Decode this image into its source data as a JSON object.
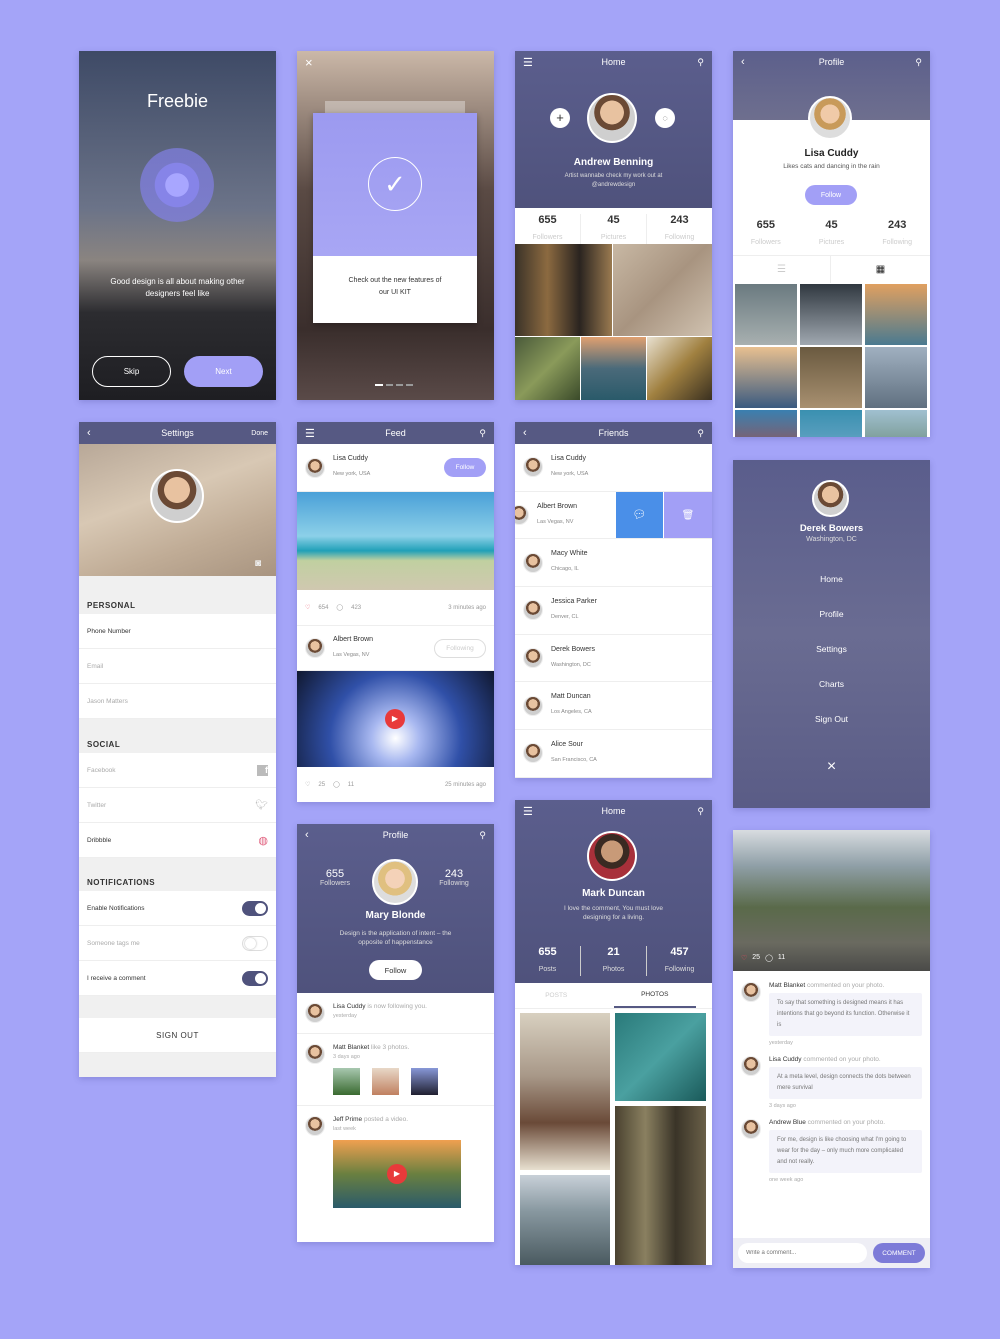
{
  "colors": {
    "background": "#a4a4f8",
    "accent": "#a29ff6",
    "header": "#565983",
    "action_blue": "#4a8fe8",
    "like_red": "#e84a5f"
  },
  "freebie": {
    "title": "Freebie",
    "tagline": "Good design is all about making other designers feel like",
    "skip": "Skip",
    "next": "Next"
  },
  "walkthrough": {
    "message": "Check out the new features of our UI KIT",
    "pages": 4,
    "active_page": 1
  },
  "home_andrew": {
    "title": "Home",
    "name": "Andrew Benning",
    "bio": "Artist wannabe check my work out at @andrewdesign",
    "stats": [
      {
        "value": "655",
        "label": "Followers"
      },
      {
        "value": "45",
        "label": "Pictures"
      },
      {
        "value": "243",
        "label": "Following"
      }
    ]
  },
  "profile_lisa": {
    "title": "Profile",
    "name": "Lisa Cuddy",
    "bio": "Likes cats and dancing in the rain",
    "follow": "Follow",
    "stats": [
      {
        "value": "655",
        "label": "Followers"
      },
      {
        "value": "45",
        "label": "Pictures"
      },
      {
        "value": "243",
        "label": "Following"
      }
    ],
    "active_view": "grid"
  },
  "settings": {
    "title": "Settings",
    "done": "Done",
    "personal": "PERSONAL",
    "personal_items": [
      "Phone Number",
      "Email",
      "Jason Matters"
    ],
    "social": "SOCIAL",
    "social_items": [
      "Facebook",
      "Twitter",
      "Dribbble"
    ],
    "notifications": "NOTIFICATIONS",
    "notification_items": [
      {
        "label": "Enable Notifications",
        "on": true
      },
      {
        "label": "Someone tags me",
        "on": false
      },
      {
        "label": "I receive a comment",
        "on": true
      }
    ],
    "sign_out": "SIGN OUT"
  },
  "feed": {
    "title": "Feed",
    "posts": [
      {
        "name": "Lisa Cuddy",
        "location": "New york, USA",
        "button": "Follow",
        "likes": "654",
        "comments": "423",
        "time": "3 minutes ago"
      },
      {
        "name": "Albert Brown",
        "location": "Las Vegas, NV",
        "button": "Following",
        "likes": "25",
        "comments": "11",
        "time": "25 minutes ago"
      }
    ]
  },
  "friends": {
    "title": "Friends",
    "items": [
      {
        "name": "Lisa Cuddy",
        "location": "New york, USA"
      },
      {
        "name": "Albert Brown",
        "location": "Las Vegas, NV"
      },
      {
        "name": "Macy White",
        "location": "Chicago, IL"
      },
      {
        "name": "Jessica Parker",
        "location": "Denver, CL"
      },
      {
        "name": "Derek Bowers",
        "location": "Washington, DC"
      },
      {
        "name": "Matt Duncan",
        "location": "Los Angeles, CA"
      },
      {
        "name": "Alice Sour",
        "location": "San Francisco, CA"
      }
    ]
  },
  "menu": {
    "name": "Derek Bowers",
    "location": "Washington, DC",
    "items": [
      "Home",
      "Profile",
      "Settings",
      "Charts",
      "Sign Out"
    ]
  },
  "profile_mary": {
    "title": "Profile",
    "name": "Mary Blonde",
    "bio": "Design is the application of intent – the opposite of happenstance",
    "follow": "Follow",
    "followers": {
      "value": "655",
      "label": "Followers"
    },
    "following": {
      "value": "243",
      "label": "Following"
    },
    "activity": [
      {
        "name": "Lisa Cuddy",
        "action": "is now following you.",
        "time": "yesterday"
      },
      {
        "name": "Matt Blanket",
        "action": "like 3 photos.",
        "time": "3 days ago"
      },
      {
        "name": "Jeff Prime",
        "action": "posted a video.",
        "time": "last week"
      }
    ]
  },
  "home_mark": {
    "title": "Home",
    "name": "Mark Duncan",
    "bio": "I love the comment, You must love designing for a living.",
    "stats": [
      {
        "value": "655",
        "label": "Posts"
      },
      {
        "value": "21",
        "label": "Photos"
      },
      {
        "value": "457",
        "label": "Following"
      }
    ],
    "tabs": [
      "POSTS",
      "PHOTOS"
    ],
    "active_tab": "PHOTOS"
  },
  "comments": {
    "likes": "25",
    "comment_count": "11",
    "items": [
      {
        "name": "Matt Blanket",
        "action": "commented on your photo.",
        "text": "To say that something is designed means it has intentions that go beyond its function. Otherwise it is",
        "time": "yesterday"
      },
      {
        "name": "Lisa Cuddy",
        "action": "commented on your photo.",
        "text": "At a meta level, design connects the dots between mere survival",
        "time": "3 days ago"
      },
      {
        "name": "Andrew Blue",
        "action": "commented on your photo.",
        "text": "For me, design is like choosing what I'm going to wear for the day – only much more complicated and not really.",
        "time": "one week ago"
      }
    ],
    "placeholder": "Write a comment...",
    "button": "COMMENT"
  }
}
